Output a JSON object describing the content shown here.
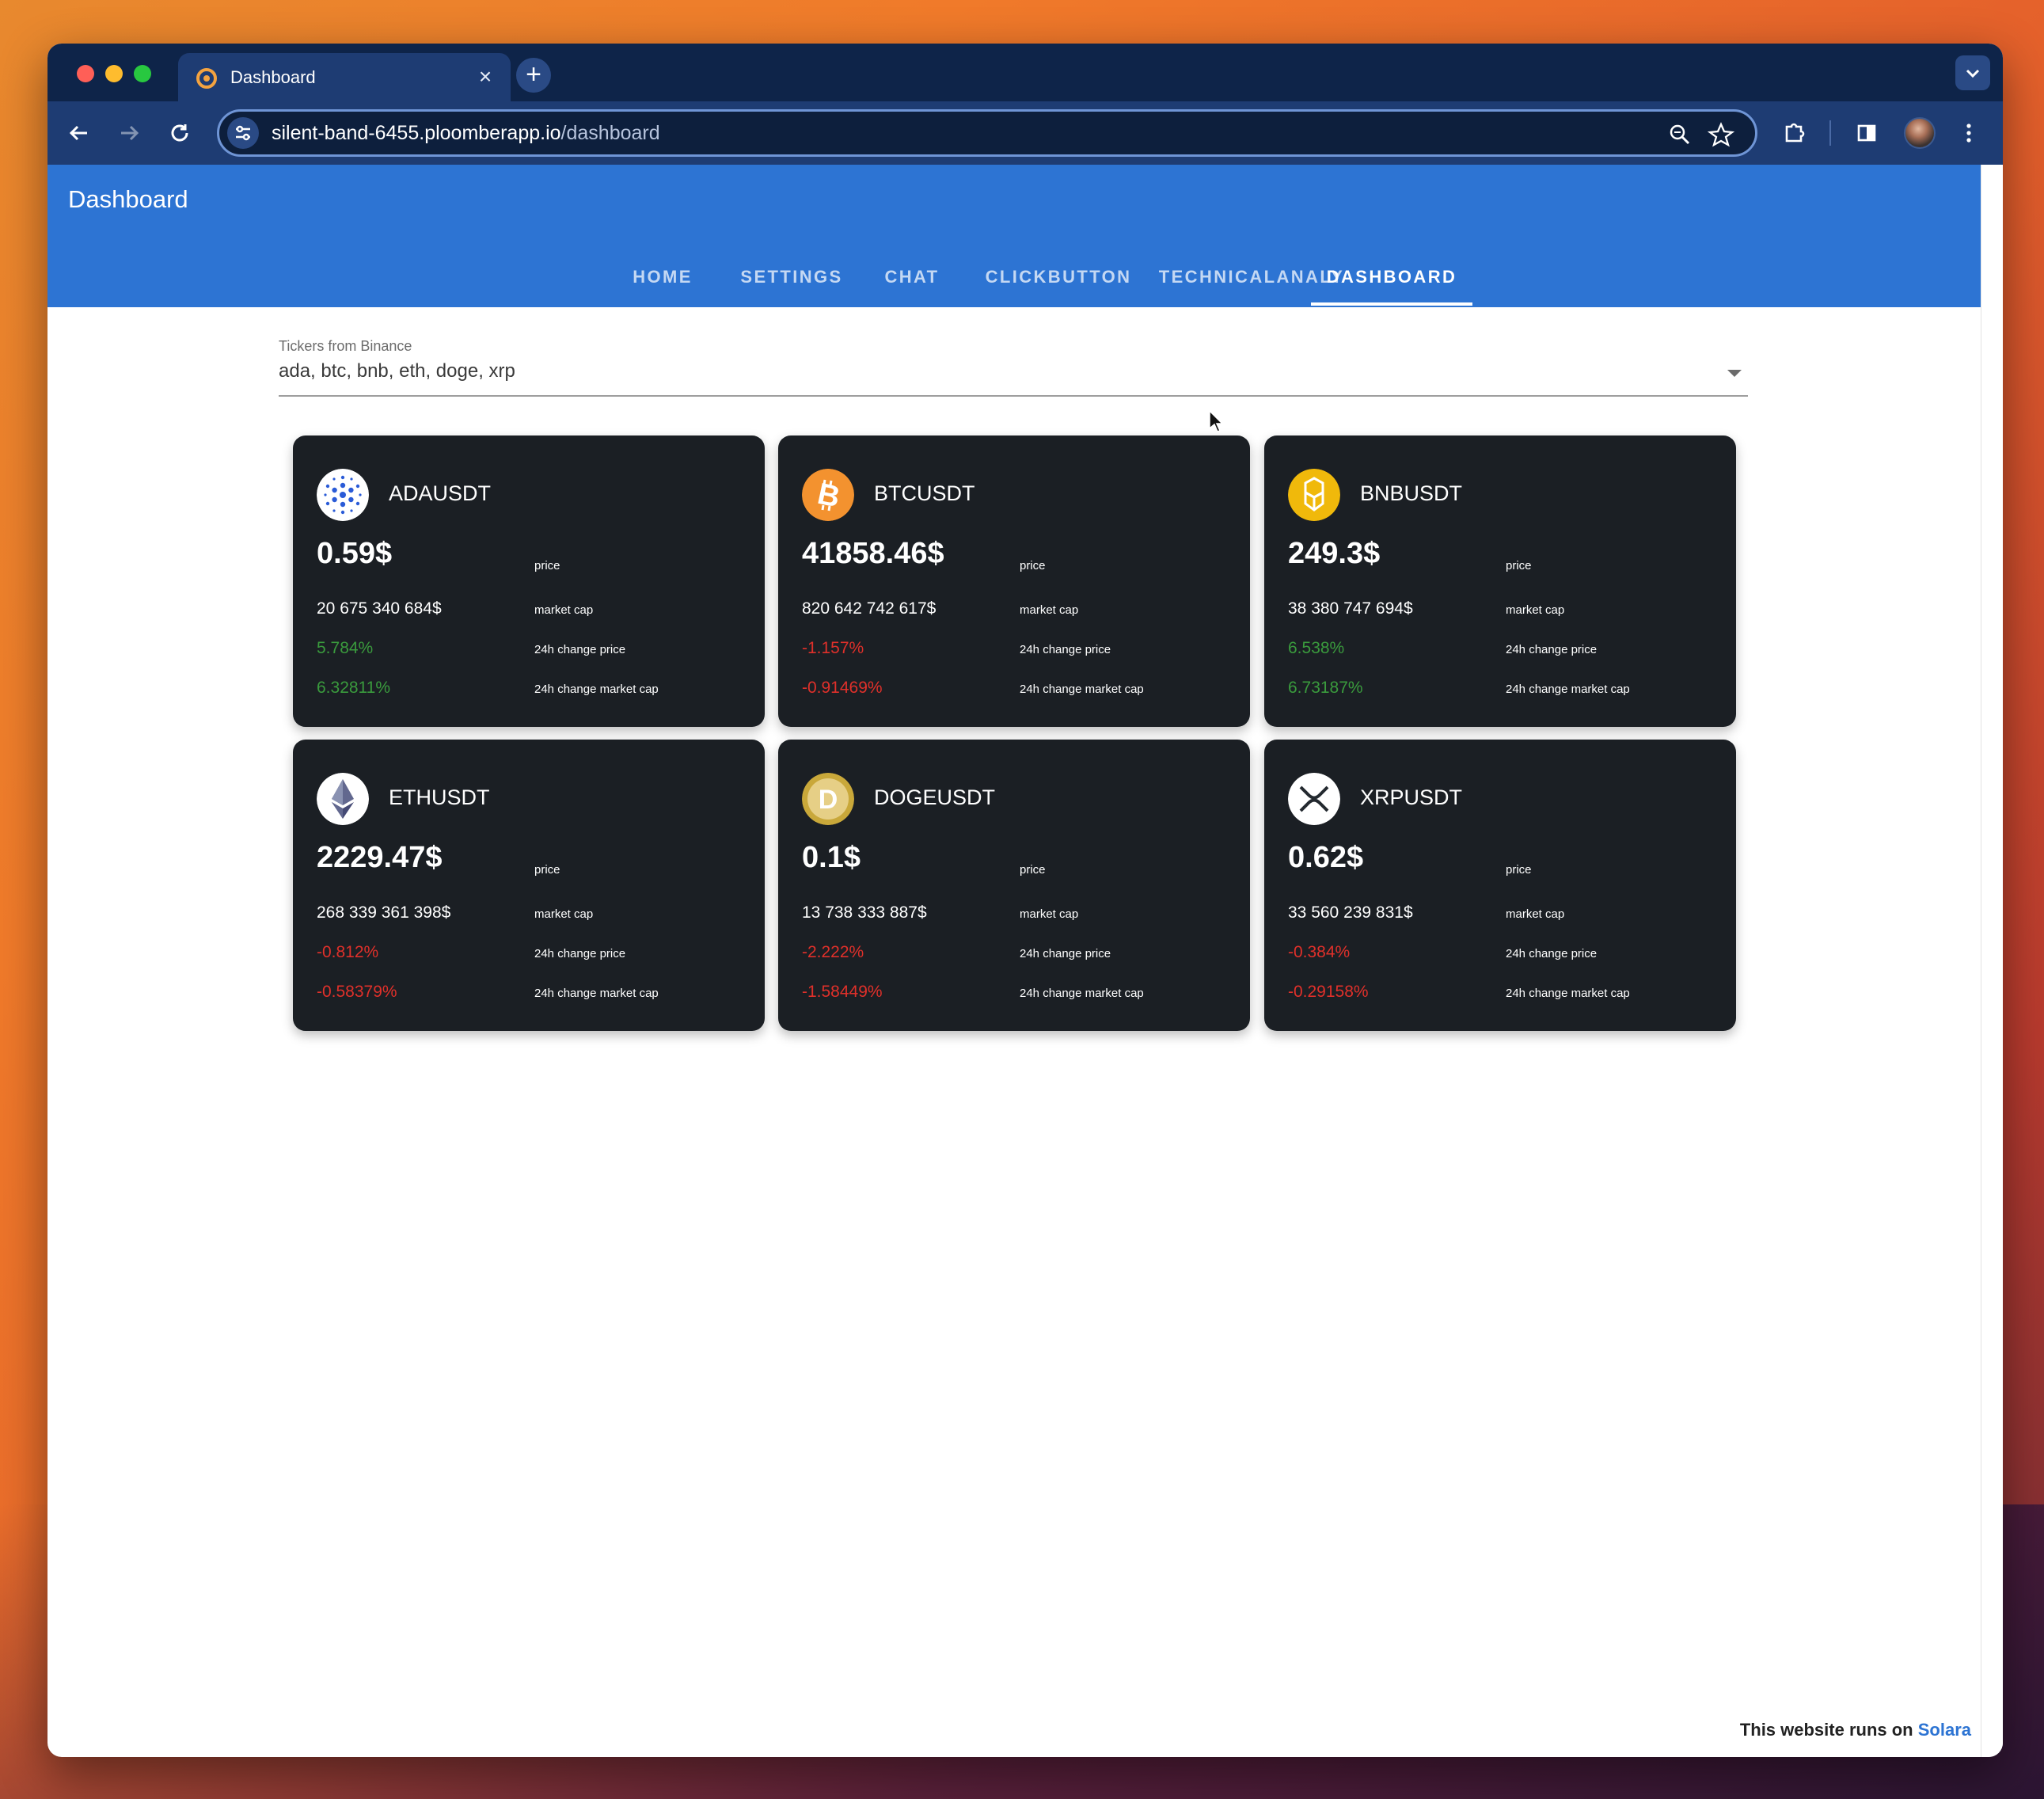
{
  "browser": {
    "tab_title": "Dashboard",
    "url_host": "silent-band-6455.ploomberapp.io",
    "url_path": "/dashboard"
  },
  "app": {
    "title": "Dashboard",
    "nav": [
      "HOME",
      "SETTINGS",
      "CHAT",
      "CLICKBUTTON",
      "TECHNICALANALY",
      "DASHBOARD"
    ],
    "active_nav": "DASHBOARD"
  },
  "ticker_select": {
    "label": "Tickers from Binance",
    "value": "ada, btc, bnb, eth, doge, xrp"
  },
  "labels": {
    "price": "price",
    "market_cap": "market cap",
    "change_price": "24h change price",
    "change_market_cap": "24h change market cap"
  },
  "cards": [
    {
      "symbol": "ADAUSDT",
      "icon": "cardano-icon",
      "price": "0.59$",
      "market_cap": "20 675 340 684$",
      "change_price": "5.784%",
      "change_market_cap": "6.32811%",
      "trend": "up"
    },
    {
      "symbol": "BTCUSDT",
      "icon": "bitcoin-icon",
      "price": "41858.46$",
      "market_cap": "820 642 742 617$",
      "change_price": "-1.157%",
      "change_market_cap": "-0.91469%",
      "trend": "down"
    },
    {
      "symbol": "BNBUSDT",
      "icon": "bnb-icon",
      "price": "249.3$",
      "market_cap": "38 380 747 694$",
      "change_price": "6.538%",
      "change_market_cap": "6.73187%",
      "trend": "up"
    },
    {
      "symbol": "ETHUSDT",
      "icon": "ethereum-icon",
      "price": "2229.47$",
      "market_cap": "268 339 361 398$",
      "change_price": "-0.812%",
      "change_market_cap": "-0.58379%",
      "trend": "down"
    },
    {
      "symbol": "DOGEUSDT",
      "icon": "dogecoin-icon",
      "price": "0.1$",
      "market_cap": "13 738 333 887$",
      "change_price": "-2.222%",
      "change_market_cap": "-1.58449%",
      "trend": "down"
    },
    {
      "symbol": "XRPUSDT",
      "icon": "xrp-icon",
      "price": "0.62$",
      "market_cap": "33 560 239 831$",
      "change_price": "-0.384%",
      "change_market_cap": "-0.29158%",
      "trend": "down"
    }
  ],
  "footer": {
    "text": "This website runs on ",
    "link": "Solara"
  },
  "colors": {
    "header_blue": "#2d74d3",
    "card_bg": "#1b1f24",
    "positive": "#3a9b3d",
    "negative": "#e0302a"
  }
}
